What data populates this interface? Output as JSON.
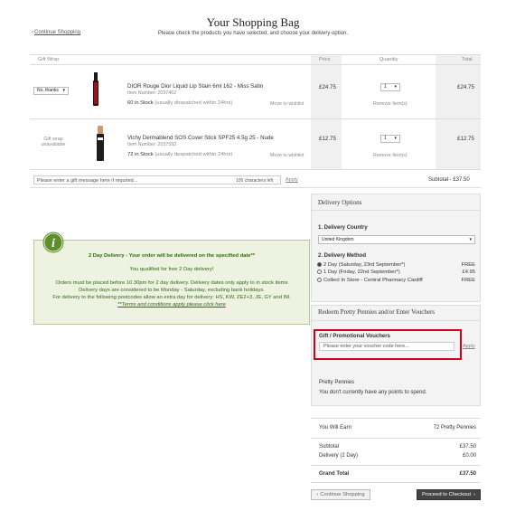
{
  "header": {
    "title": "Your Shopping Bag",
    "subtitle": "Please check the products you have selected, and choose your delivery option.",
    "continue_link": "Continue Shopping"
  },
  "table": {
    "col_gift_wrap": "Gift Wrap",
    "col_price": "Price",
    "col_quantity": "Quantity",
    "col_total": "Total"
  },
  "products": [
    {
      "gift_option": "No, thanks",
      "name": "DIOR Rouge Dior Liquid Lip Stain 6ml 162 - Miss Satin",
      "item_number": "Item Number: 2037462",
      "stock": "60 in Stock",
      "stock_note": "(usually despatched within 24hrs)",
      "wishlist": "Move to wishlist",
      "price": "£24.75",
      "qty": "1",
      "remove": "Remove Item(s)",
      "total": "£24.75"
    },
    {
      "gift_option": "Gift wrap unavailable",
      "name": "Vichy Dermablend SOS Cover Stick SPF25 4.5g 25 - Nude",
      "item_number": "Item Number: 2037592",
      "stock": "72 in Stock",
      "stock_note": "(usually despatched within 24hrs)",
      "wishlist": "Move to wishlist",
      "price": "£12.75",
      "qty": "1",
      "remove": "Remove Item(s)",
      "total": "£12.75"
    }
  ],
  "gift_message": {
    "placeholder": "Please enter a gift message here if required...",
    "chars_left": "100 characters left",
    "apply": "Apply"
  },
  "subtotal_line": "Subtotal -  £37.50",
  "delivery_info": {
    "heading": "2 Day Delivery - Your order will be delivered on the specified date**",
    "qualified": "You qualified for free 2 Day delivery!",
    "line1": "Orders must be placed before 10.30pm for 2 day delivery. Delivery dates only apply to in stock items",
    "line2": "Delivery days are considered to be Monday - Saturday, excluding bank holidays.",
    "line3": "For delivery to the following postcodes allow an extra day for delivery: HS, KW, ZE2+3, JE, GY and IM.",
    "terms": "**Terms and conditions apply please click here"
  },
  "delivery_options": {
    "title": "Delivery Options",
    "country_label": "1. Delivery Country",
    "country_value": "United Kingdom",
    "method_label": "2. Delivery Method",
    "methods": [
      {
        "label": "2 Day (Saturday, 23rd September*)",
        "price": "FREE"
      },
      {
        "label": "1 Day (Friday, 22nd September*)",
        "price": "£4.95"
      },
      {
        "label": "Collect In Store - Central Pharmacy Cardiff",
        "price": "FREE"
      }
    ]
  },
  "vouchers": {
    "title": "Redeem Pretty Pennies and/or Enter Vouchers",
    "gift_label": "Gift / Promotional Vouchers",
    "placeholder": "Please enter your voucher code here...",
    "apply": "Apply",
    "pennies_label": "Pretty Pennies",
    "pennies_text": "You don't currently have any points to spend."
  },
  "summary": {
    "earn_label": "You Will Earn",
    "earn_value": "72 Pretty Pennies",
    "subtotal_label": "Subtotal",
    "subtotal_value": "£37.50",
    "delivery_label": "Delivery (2 Day)",
    "delivery_value": "£0.00",
    "grand_label": "Grand Total",
    "grand_value": "£37.50"
  },
  "buttons": {
    "continue": "Continue Shopping",
    "checkout": "Proceed to Checkout"
  },
  "colors": {
    "highlight_red": "#d0021b",
    "info_green": "#2f6a12",
    "info_bg": "#eef2e1"
  }
}
